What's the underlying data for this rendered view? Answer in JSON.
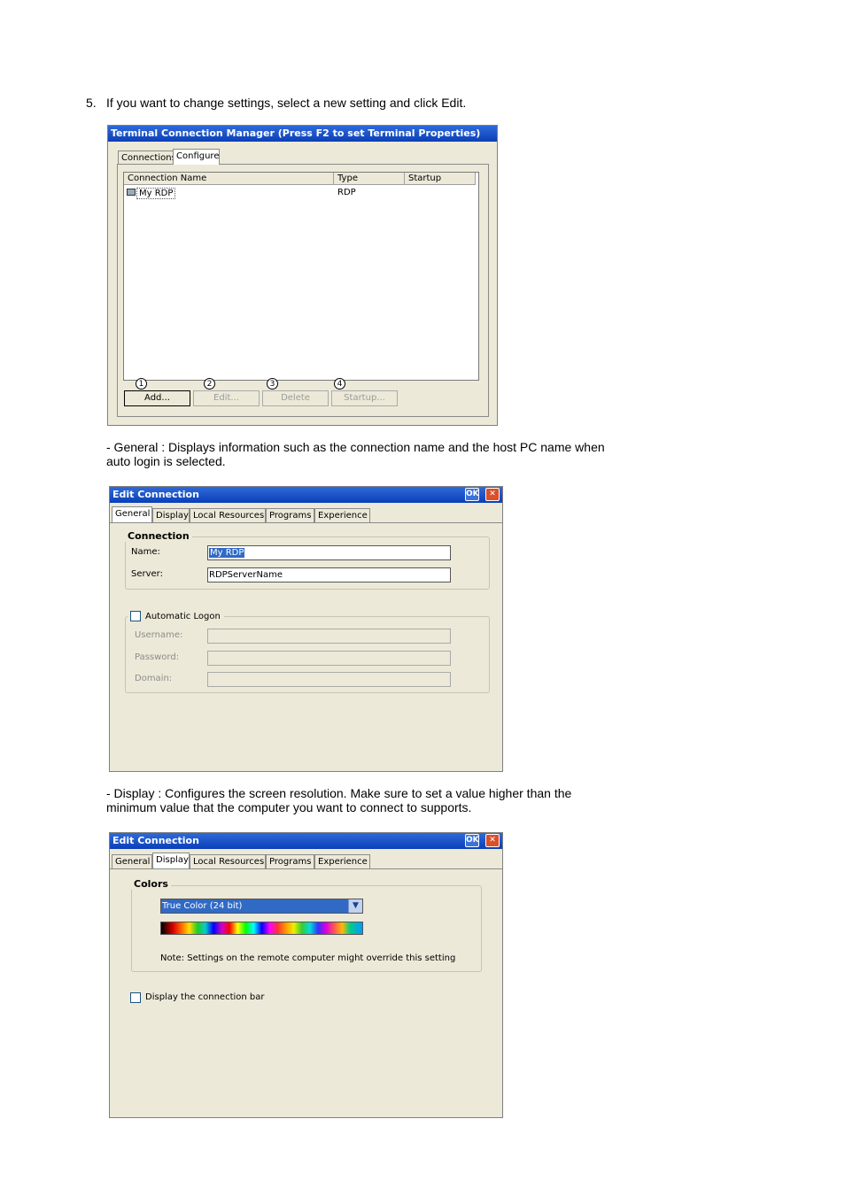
{
  "step5": {
    "number": "5.",
    "text": "If you want to change settings, select a new setting and click Edit."
  },
  "tcm": {
    "title": "Terminal Connection Manager (Press F2 to set Terminal Properties)",
    "tabs": [
      "Connections",
      "Configure"
    ],
    "columns": [
      "Connection Name",
      "Type",
      "Startup"
    ],
    "rows": [
      {
        "name": "My RDP",
        "type": "RDP",
        "startup": ""
      }
    ],
    "buttons": [
      {
        "marker": "1",
        "label": "Add..."
      },
      {
        "marker": "2",
        "label": "Edit..."
      },
      {
        "marker": "3",
        "label": "Delete"
      },
      {
        "marker": "4",
        "label": "Startup..."
      }
    ]
  },
  "general_desc": {
    "line1": "- General : Displays information such as the connection name and the host PC name when",
    "line2": "auto login is selected."
  },
  "edit_general": {
    "title": "Edit Connection",
    "ok": "OK",
    "close": "✕",
    "tabs": [
      "General",
      "Display",
      "Local Resources",
      "Programs",
      "Experience"
    ],
    "connection_group": "Connection",
    "name_label": "Name:",
    "name_value": "My RDP",
    "server_label": "Server:",
    "server_value": "RDPServerName",
    "auto_logon_label": "Automatic Logon",
    "username_label": "Username:",
    "password_label": "Password:",
    "domain_label": "Domain:"
  },
  "display_desc": {
    "line1": "- Display : Configures the screen resolution. Make sure to set a value higher than the",
    "line2": "minimum value that the computer you want to connect to supports."
  },
  "edit_display": {
    "title": "Edit Connection",
    "ok": "OK",
    "close": "✕",
    "tabs": [
      "General",
      "Display",
      "Local Resources",
      "Programs",
      "Experience"
    ],
    "colors_group": "Colors",
    "color_value": "True Color (24 bit)",
    "note": "Note: Settings on the remote computer might override this setting",
    "connection_bar_label": "Display the connection bar"
  }
}
